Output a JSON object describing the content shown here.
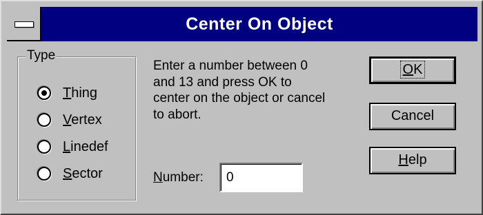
{
  "window": {
    "title": "Center On Object"
  },
  "type_group": {
    "label": "Type",
    "options": [
      {
        "pre": "",
        "ul": "T",
        "post": "hing",
        "selected": true
      },
      {
        "pre": "",
        "ul": "V",
        "post": "ertex",
        "selected": false
      },
      {
        "pre": "",
        "ul": "L",
        "post": "inedef",
        "selected": false
      },
      {
        "pre": "",
        "ul": "S",
        "post": "ector",
        "selected": false
      }
    ]
  },
  "instructions": {
    "lines": [
      "Enter a number between 0",
      "and 13 and press OK to",
      "center on the object or cancel",
      "to abort."
    ]
  },
  "number": {
    "label_ul": "N",
    "label_rest": "umber:",
    "value": "0"
  },
  "buttons": {
    "ok": {
      "ul": "O",
      "rest": "K"
    },
    "cancel": "Cancel",
    "help": {
      "ul": "H",
      "rest": "elp"
    }
  },
  "colors": {
    "titlebar": "#000080",
    "face": "#c0c0c0"
  }
}
